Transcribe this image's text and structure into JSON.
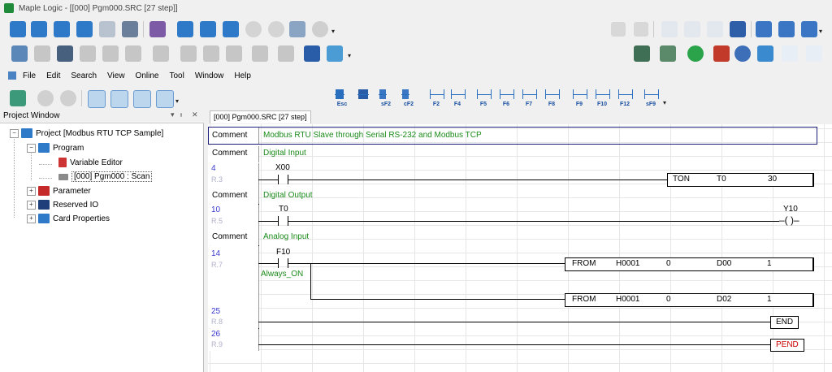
{
  "window": {
    "title": "Maple Logic - [[000] Pgm000.SRC [27 step]]"
  },
  "menu": [
    "File",
    "Edit",
    "Search",
    "View",
    "Online",
    "Tool",
    "Window",
    "Help"
  ],
  "project_window": {
    "title": "Project Window",
    "pin": "▾ ᵻ ✕",
    "tree": {
      "project": "Project [Modbus RTU TCP Sample]",
      "program": "Program",
      "variable_editor": "Variable Editor",
      "pgm": "[000] Pgm000 : Scan",
      "parameter": "Parameter",
      "reserved_io": "Reserved IO",
      "card_properties": "Card Properties"
    }
  },
  "fkeys": [
    "Esc",
    "",
    "sF2",
    "cF2",
    "F2",
    "F4",
    "F5",
    "F6",
    "F7",
    "F8",
    "F9",
    "F10",
    "F12",
    "sF9"
  ],
  "editor": {
    "tab": "[000] Pgm000.SRC [27 step]",
    "rows": {
      "c1_label": "Comment",
      "c1_text": "Modbus RTU Slave through Serial RS-232 and Modbus TCP",
      "c2_label": "Comment",
      "c2_text": "Digital Input",
      "r4_step": "4",
      "r4_line": "R.3",
      "r4_contact": "X00",
      "r4_fn": "TON",
      "r4_a": "T0",
      "r4_b": "30",
      "c3_label": "Comment",
      "c3_text": "Digital Output",
      "r10_step": "10",
      "r10_line": "R.5",
      "r10_contact": "T0",
      "r10_coil_label": "Y10",
      "r10_coil": "–( )–",
      "c4_label": "Comment",
      "c4_text": "Analog Input",
      "r14_step": "14",
      "r14_line": "R.7",
      "r14_contact": "F10",
      "r14_alias": "Always_ON",
      "from1": [
        "FROM",
        "H0001",
        "0",
        "D00",
        "1"
      ],
      "from2": [
        "FROM",
        "H0001",
        "0",
        "D02",
        "1"
      ],
      "r25_step": "25",
      "r25_line": "R.8",
      "r25_end": "END",
      "r26_step": "26",
      "r26_line": "R.9",
      "r26_pend": "PEND"
    }
  },
  "colors": {
    "comment_green": "#1a8a1a",
    "step_blue": "#3a3ad0",
    "pend_red": "#cc0000"
  }
}
